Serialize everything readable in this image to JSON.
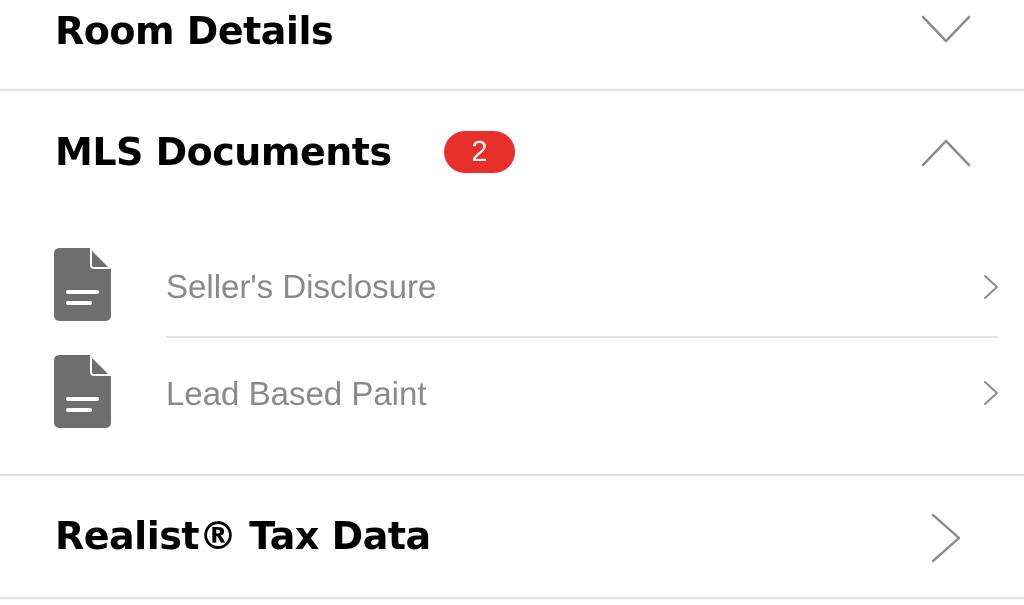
{
  "sections": {
    "room_details": {
      "title": "Room Details",
      "state": "collapsed",
      "chevron_icon": "chevron-down-icon"
    },
    "mls_documents": {
      "title": "MLS Documents",
      "badge_count": "2",
      "state": "expanded",
      "chevron_icon": "chevron-up-icon",
      "documents": [
        {
          "label": "Seller's Disclosure",
          "icon": "document-icon",
          "arrow_icon": "chevron-right-icon"
        },
        {
          "label": "Lead Based Paint",
          "icon": "document-icon",
          "arrow_icon": "chevron-right-icon"
        }
      ]
    },
    "realist_tax_data": {
      "title": "Realist® Tax Data",
      "state": "collapsed",
      "chevron_icon": "chevron-right-icon"
    }
  },
  "colors": {
    "badge_background": "#e8302a",
    "doc_icon": "#6e6e6e",
    "chevron": "#8c8c8c",
    "doc_label": "#8a8a8a"
  }
}
